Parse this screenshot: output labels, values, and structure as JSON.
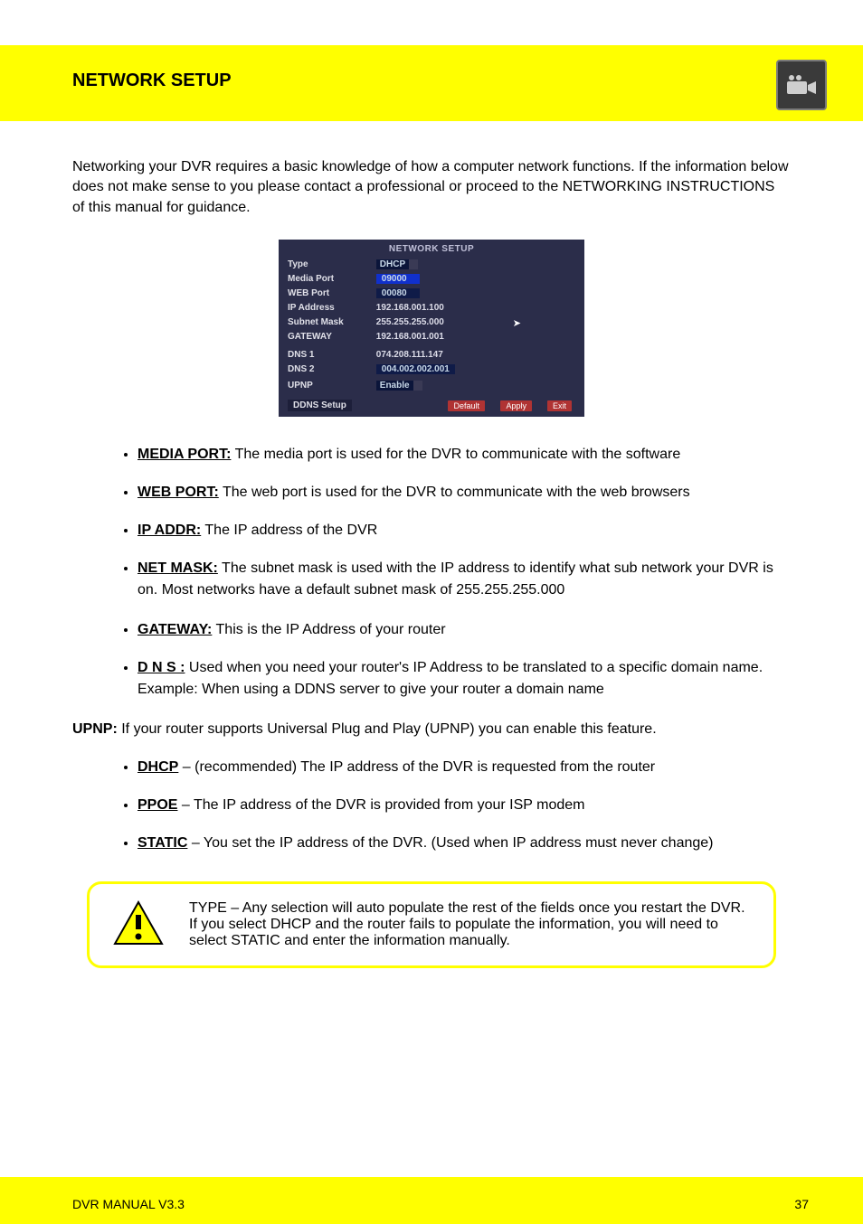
{
  "header": {
    "title": "NETWORK SETUP",
    "icon": "camera-icon"
  },
  "intro": "Networking your DVR requires a basic knowledge of how a computer network functions. If the information below does not make sense to you please contact a professional or proceed to the NETWORKING INSTRUCTIONS of this manual for guidance.",
  "screenshot": {
    "title": "NETWORK  SETUP",
    "rows": [
      {
        "label": "Type",
        "value": "DHCP",
        "kind": "dropdown"
      },
      {
        "label": "Media  Port",
        "value": "09000",
        "kind": "input_sel"
      },
      {
        "label": "WEB  Port",
        "value": "00080",
        "kind": "input"
      },
      {
        "label": "IP  Address",
        "value": "192.168.001.100",
        "kind": "text"
      },
      {
        "label": "Subnet  Mask",
        "value": "255.255.255.000",
        "kind": "text"
      },
      {
        "label": "GATEWAY",
        "value": "192.168.001.001",
        "kind": "text"
      },
      {
        "label": "DNS  1",
        "value": "074.208.111.147",
        "kind": "text"
      },
      {
        "label": "DNS  2",
        "value": "004.002.002.001",
        "kind": "input"
      },
      {
        "label": "UPNP",
        "value": "Enable",
        "kind": "dropdown"
      }
    ],
    "ddns_label": "DDNS  Setup",
    "btn_default": "Default",
    "btn_apply": "Apply",
    "btn_exit": "Exit"
  },
  "list_a": [
    {
      "term": "MEDIA PORT:",
      "desc": "The media port is used for the DVR to communicate with the software"
    },
    {
      "term": "WEB PORT:",
      "desc": "The web port is used for the DVR to communicate with the web browsers"
    },
    {
      "term": "IP ADDR:",
      "desc": "The IP address of the DVR"
    },
    {
      "term": "NET MASK:",
      "desc": "The subnet mask is used with the IP address to identify what sub network your DVR is on. Most networks have a default subnet mask of 255.255.255.000"
    }
  ],
  "list_b": [
    {
      "term": "GATEWAY:",
      "desc": "This is the IP Address of your router"
    },
    {
      "term": "D N S :",
      "desc": " Used when you need your router's IP Address to be translated to a specific domain name. Example: When using a DDNS server to give your router a domain name"
    }
  ],
  "upnp_prefix": "UPNP:",
  "upnp_text": " If your router supports Universal Plug and Play (UPNP) you can enable this feature.",
  "list_c": [
    {
      "term": "DHCP",
      "desc": " – (recommended) The IP address of the DVR is requested from the router"
    },
    {
      "term": "PPOE",
      "desc": " – The IP address of the DVR is provided from your ISP modem"
    },
    {
      "term": "STATIC",
      "desc": " – You set the IP address of the DVR. (Used when IP address must never change)"
    }
  ],
  "callout": "TYPE – Any selection will auto populate the rest of the fields once you restart the DVR. If you select DHCP and the router fails to populate the information, you will need to select STATIC and enter the information manually.",
  "footer": {
    "text": "DVR MANUAL V3.3",
    "page": "37"
  }
}
